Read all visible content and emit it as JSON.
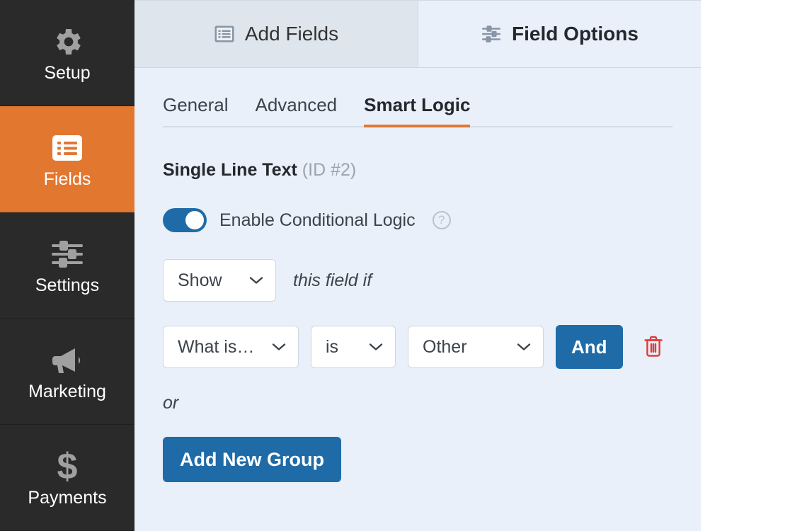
{
  "sidebar": {
    "items": [
      {
        "label": "Setup",
        "icon": "gear-icon",
        "active": false
      },
      {
        "label": "Fields",
        "icon": "list-form-icon",
        "active": true
      },
      {
        "label": "Settings",
        "icon": "sliders-icon",
        "active": false
      },
      {
        "label": "Marketing",
        "icon": "megaphone-icon",
        "active": false
      },
      {
        "label": "Payments",
        "icon": "dollar-sign-icon",
        "active": false
      }
    ]
  },
  "top_tabs": [
    {
      "label": "Add Fields",
      "icon": "form-list-icon",
      "active": false
    },
    {
      "label": "Field Options",
      "icon": "sliders-icon",
      "active": true
    }
  ],
  "sub_tabs": [
    {
      "label": "General",
      "active": false
    },
    {
      "label": "Advanced",
      "active": false
    },
    {
      "label": "Smart Logic",
      "active": true
    }
  ],
  "field": {
    "name": "Single Line Text",
    "id_text": "(ID #2)"
  },
  "conditional": {
    "toggle_label": "Enable Conditional Logic",
    "toggle_on": true,
    "help_glyph": "?",
    "action_select": "Show",
    "this_field_if": "this field if",
    "rules": [
      {
        "field_select": "What is…",
        "operator_select": "is",
        "value_select": "Other",
        "and_label": "And",
        "delete_icon": "trash-icon"
      }
    ],
    "or_label": "or",
    "add_group_label": "Add New Group"
  },
  "colors": {
    "accent_orange": "#e27730",
    "accent_blue": "#1e6ba8",
    "panel_bg": "#e9f0fa",
    "sidebar_bg": "#2a2a2a",
    "inactive_tab_bg": "#dfe5ec",
    "danger_red": "#e03b3b"
  }
}
